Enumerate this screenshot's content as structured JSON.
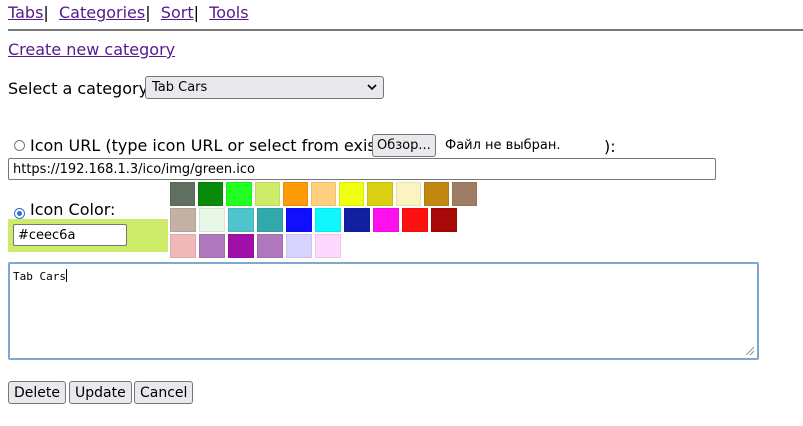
{
  "nav": {
    "tabs": "Tabs",
    "categories": "Categories",
    "sort": "Sort",
    "tools": "Tools",
    "separator": "|"
  },
  "create_link": "Create new category",
  "select": {
    "label": "Select a category:",
    "value": "Tab Cars"
  },
  "icon_url": {
    "label": "Icon URL (type icon URL or select from existing",
    "browse_button": "Обзор...",
    "file_status": "Файл не выбран.",
    "closing": "):",
    "value": "https://192.168.1.3/ico/img/green.ico"
  },
  "icon_color": {
    "label": "Icon Color:",
    "value": "#ceec6a",
    "selected_color": "#ceec6a"
  },
  "palette": [
    [
      "#607060",
      "#0a8a0a",
      "#22ff22",
      "#ceec6a",
      "#ff9a0a",
      "#ffd080",
      "#eeff10",
      "#d8d010",
      "#fbf4c0",
      "#c08810",
      "#a07c64"
    ],
    [
      "#c4b0a4",
      "#e8f8e8",
      "#50c4cc",
      "#30a8ac",
      "#1010ff",
      "#10f8ff",
      "#1020a0",
      "#ff10ee",
      "#ff1010",
      "#a80808"
    ],
    [
      "#f0b8b8",
      "#b078bc",
      "#a010a8",
      "#b078bc",
      "#d8d4ff",
      "#ffd8ff"
    ]
  ],
  "textarea": {
    "value": "Tab Cars"
  },
  "buttons": {
    "delete": "Delete",
    "update": "Update",
    "cancel": "Cancel"
  }
}
